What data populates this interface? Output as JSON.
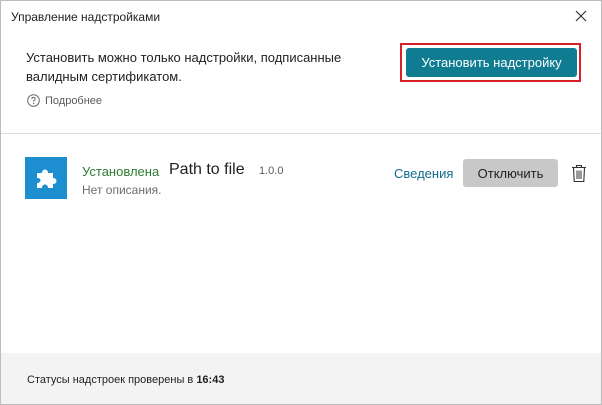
{
  "window": {
    "title": "Управление надстройками"
  },
  "header": {
    "notice": "Установить можно только надстройки, подписанные валидным сертификатом.",
    "more_label": "Подробнее",
    "install_label": "Установить надстройку",
    "highlight_color": "#d8202a",
    "accent_color": "#0f7c91"
  },
  "addon": {
    "icon": "puzzle-icon",
    "status": "Установлена",
    "name": "Path to file",
    "version": "1.0.0",
    "description": "Нет описания.",
    "details_label": "Сведения",
    "disable_label": "Отключить",
    "delete_icon": "trash-icon"
  },
  "footer": {
    "status_prefix": "Статусы надстроек проверены в ",
    "status_time": "16:43"
  }
}
